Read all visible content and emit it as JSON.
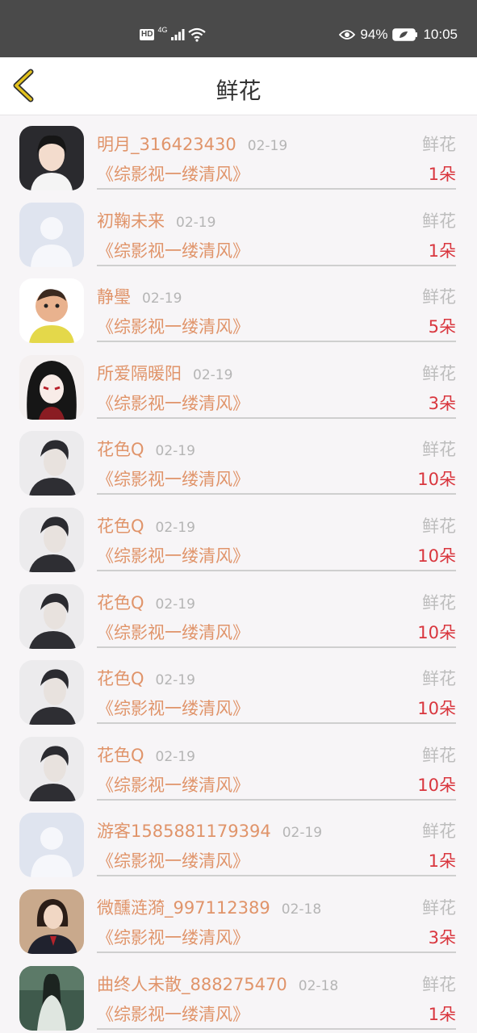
{
  "status_bar": {
    "hd": "HD",
    "network": "4G",
    "battery_percent": "94%",
    "time": "10:05",
    "icons": [
      "signal-icon",
      "wifi-icon",
      "eye-icon",
      "battery-icon"
    ]
  },
  "header": {
    "title": "鲜花",
    "back_icon": "chevron-left-icon",
    "accent": "#e3c21d"
  },
  "colors": {
    "name": "#e0946a",
    "count": "#d9363e",
    "muted": "#b5b5b5"
  },
  "records": [
    {
      "name": "明月_316423430",
      "date": "02-19",
      "gift": "鲜花",
      "book": "《综影视一缕清风》",
      "count": "1朵",
      "avatar": "girl-photo"
    },
    {
      "name": "初鞠未来",
      "date": "02-19",
      "gift": "鲜花",
      "book": "《综影视一缕清风》",
      "count": "1朵",
      "avatar": "default"
    },
    {
      "name": "静璺",
      "date": "02-19",
      "gift": "鲜花",
      "book": "《综影视一缕清风》",
      "count": "5朵",
      "avatar": "baby"
    },
    {
      "name": "所爱隔暖阳",
      "date": "02-19",
      "gift": "鲜花",
      "book": "《综影视一缕清风》",
      "count": "3朵",
      "avatar": "anime"
    },
    {
      "name": "花色Q",
      "date": "02-19",
      "gift": "鲜花",
      "book": "《综影视一缕清风》",
      "count": "10朵",
      "avatar": "boy"
    },
    {
      "name": "花色Q",
      "date": "02-19",
      "gift": "鲜花",
      "book": "《综影视一缕清风》",
      "count": "10朵",
      "avatar": "boy"
    },
    {
      "name": "花色Q",
      "date": "02-19",
      "gift": "鲜花",
      "book": "《综影视一缕清风》",
      "count": "10朵",
      "avatar": "boy"
    },
    {
      "name": "花色Q",
      "date": "02-19",
      "gift": "鲜花",
      "book": "《综影视一缕清风》",
      "count": "10朵",
      "avatar": "boy"
    },
    {
      "name": "花色Q",
      "date": "02-19",
      "gift": "鲜花",
      "book": "《综影视一缕清风》",
      "count": "10朵",
      "avatar": "boy"
    },
    {
      "name": "游客1585881179394",
      "date": "02-19",
      "gift": "鲜花",
      "book": "《综影视一缕清风》",
      "count": "1朵",
      "avatar": "default"
    },
    {
      "name": "微醺涟漪_997112389",
      "date": "02-18",
      "gift": "鲜花",
      "book": "《综影视一缕清风》",
      "count": "3朵",
      "avatar": "woman"
    },
    {
      "name": "曲终人未散_888275470",
      "date": "02-18",
      "gift": "鲜花",
      "book": "《综影视一缕清风》",
      "count": "1朵",
      "avatar": "painting"
    }
  ]
}
